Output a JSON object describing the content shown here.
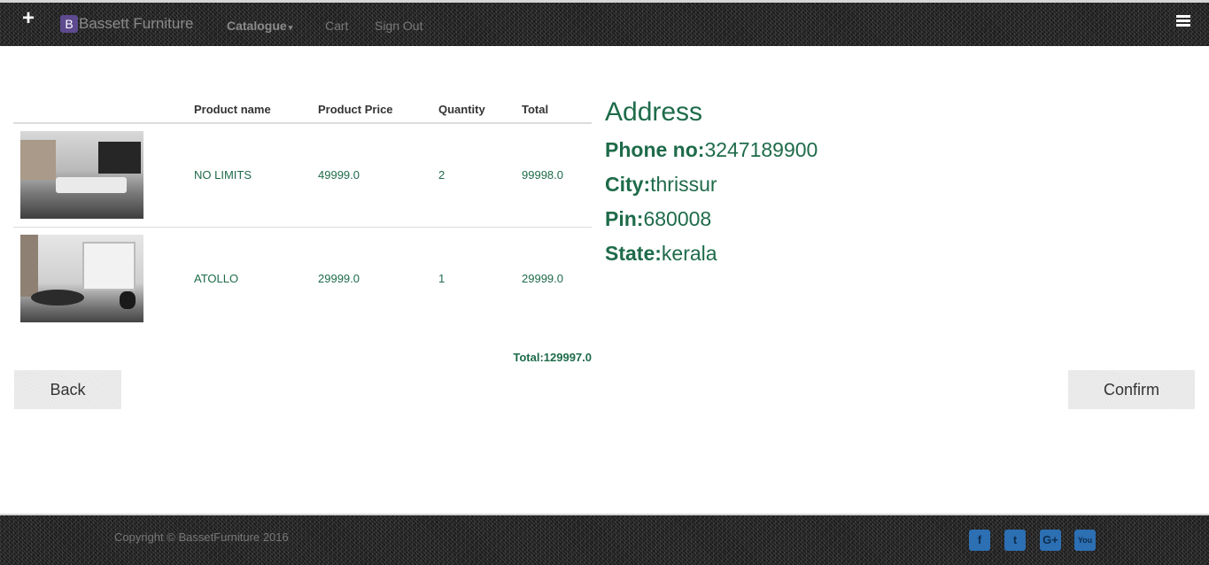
{
  "navbar": {
    "brand_badge": "B",
    "brand_name": "Bassett Furniture",
    "catalogue_label": "Catalogue",
    "cart_label": "Cart",
    "signout_label": "Sign Out"
  },
  "cart": {
    "headers": [
      "",
      "Product name",
      "Product Price",
      "Quantity",
      "Total"
    ],
    "rows": [
      {
        "name": "NO LIMITS",
        "price": "49999.0",
        "quantity": "2",
        "total": "99998.0"
      },
      {
        "name": "ATOLLO",
        "price": "29999.0",
        "quantity": "1",
        "total": "29999.0"
      }
    ],
    "grand_total": "Total:129997.0"
  },
  "address": {
    "title": "Address",
    "phone_label": "Phone no:",
    "phone": "3247189900",
    "city_label": "City:",
    "city": "thrissur",
    "pin_label": "Pin:",
    "pin": "680008",
    "state_label": "State:",
    "state": "kerala"
  },
  "buttons": {
    "back": "Back",
    "confirm": "Confirm"
  },
  "footer": {
    "copyright": "Copyright © BassetFurniture 2016",
    "social": {
      "facebook": "f",
      "twitter": "t",
      "google": "G+",
      "youtube": "You"
    }
  }
}
